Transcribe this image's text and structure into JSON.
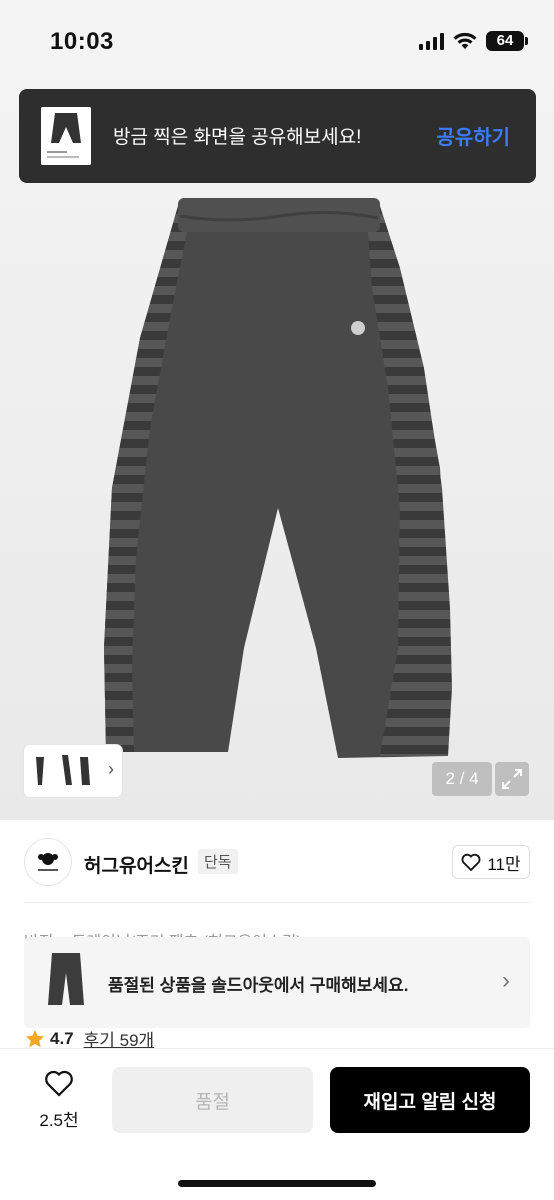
{
  "status_bar": {
    "time": "10:03",
    "battery": "64"
  },
  "share_toast": {
    "message": "방금 찍은 화면을 공유해보세요!",
    "action": "공유하기"
  },
  "gallery": {
    "page_indicator": "2 / 4",
    "thumb_chevron": "›"
  },
  "brand": {
    "name": "허그유어스킨",
    "badge": "단독",
    "likes": "11만"
  },
  "breadcrumb": "바지 > 트레이닝/조거 팬츠 (허그유어스킨)",
  "soldout_banner": {
    "text": "품절된 상품을 솔드아웃에서 구매해보세요.",
    "chevron": "›"
  },
  "rating": {
    "value": "4.7",
    "reviews": "후기 59개"
  },
  "action_bar": {
    "wish_count": "2.5천",
    "soldout_label": "품절",
    "restock_label": "재입고 알림 신청"
  },
  "colors": {
    "accent_blue": "#3a7cff",
    "star": "#f5a623",
    "primary_button": "#000000"
  }
}
